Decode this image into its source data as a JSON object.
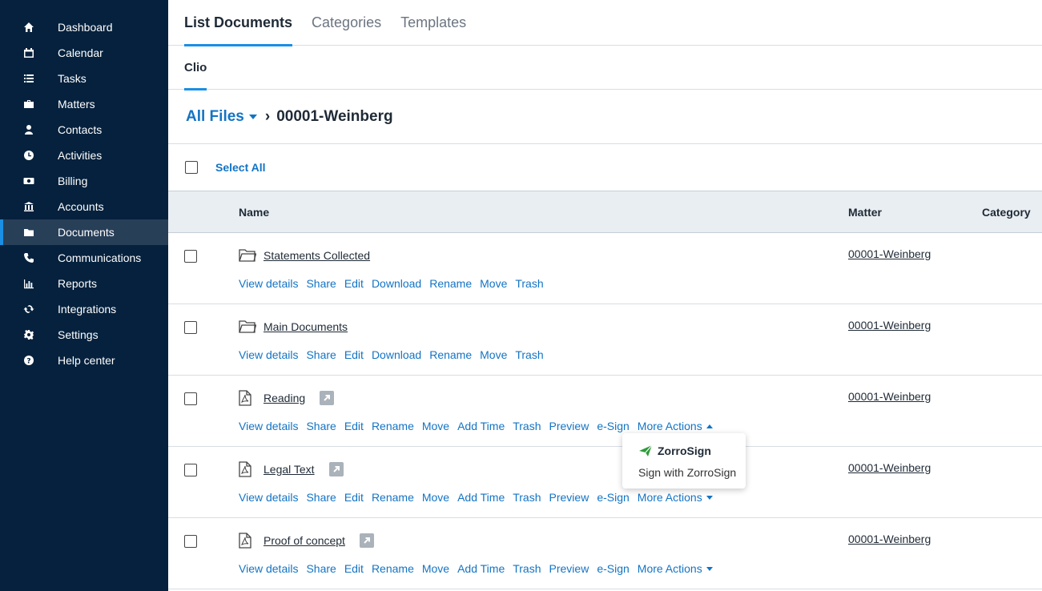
{
  "sidebar": {
    "items": [
      {
        "label": "Dashboard",
        "icon": "home-icon"
      },
      {
        "label": "Calendar",
        "icon": "calendar-icon"
      },
      {
        "label": "Tasks",
        "icon": "list-icon"
      },
      {
        "label": "Matters",
        "icon": "briefcase-icon"
      },
      {
        "label": "Contacts",
        "icon": "person-icon"
      },
      {
        "label": "Activities",
        "icon": "clock-icon"
      },
      {
        "label": "Billing",
        "icon": "money-icon"
      },
      {
        "label": "Accounts",
        "icon": "bank-icon"
      },
      {
        "label": "Documents",
        "icon": "folder-icon",
        "active": true
      },
      {
        "label": "Communications",
        "icon": "phone-icon"
      },
      {
        "label": "Reports",
        "icon": "bar-chart-icon"
      },
      {
        "label": "Integrations",
        "icon": "sync-icon"
      },
      {
        "label": "Settings",
        "icon": "gear-icon"
      },
      {
        "label": "Help center",
        "icon": "help-icon"
      }
    ]
  },
  "tabs": [
    "List Documents",
    "Categories",
    "Templates"
  ],
  "subtab": "Clio",
  "breadcrumb": {
    "root": "All Files",
    "current": "00001-Weinberg"
  },
  "select_all": "Select All",
  "columns": {
    "name": "Name",
    "matter": "Matter",
    "category": "Category"
  },
  "rows": [
    {
      "name": "Statements Collected",
      "type": "folder",
      "matter": "00001-Weinberg",
      "actions": [
        "View details",
        "Share",
        "Edit",
        "Download",
        "Rename",
        "Move",
        "Trash"
      ]
    },
    {
      "name": "Main Documents",
      "type": "folder",
      "matter": "00001-Weinberg",
      "actions": [
        "View details",
        "Share",
        "Edit",
        "Download",
        "Rename",
        "Move",
        "Trash"
      ]
    },
    {
      "name": "Reading",
      "type": "pdf",
      "matter": "00001-Weinberg",
      "actions": [
        "View details",
        "Share",
        "Edit",
        "Rename",
        "Move",
        "Add Time",
        "Trash",
        "Preview",
        "e-Sign"
      ],
      "more": "More Actions",
      "more_open": true
    },
    {
      "name": "Legal Text",
      "type": "pdf",
      "matter": "00001-Weinberg",
      "actions": [
        "View details",
        "Share",
        "Edit",
        "Rename",
        "Move",
        "Add Time",
        "Trash",
        "Preview",
        "e-Sign"
      ],
      "more": "More Actions"
    },
    {
      "name": "Proof of concept",
      "type": "pdf",
      "matter": "00001-Weinberg",
      "actions": [
        "View details",
        "Share",
        "Edit",
        "Rename",
        "Move",
        "Add Time",
        "Trash",
        "Preview",
        "e-Sign"
      ],
      "more": "More Actions"
    }
  ],
  "popup": {
    "brand": "ZorroSign",
    "item": "Sign with ZorroSign"
  },
  "colors": {
    "sidebar": "#05213d",
    "accent": "#1a8fe3",
    "link": "#1374c4",
    "brand": "#2e9c3a"
  }
}
